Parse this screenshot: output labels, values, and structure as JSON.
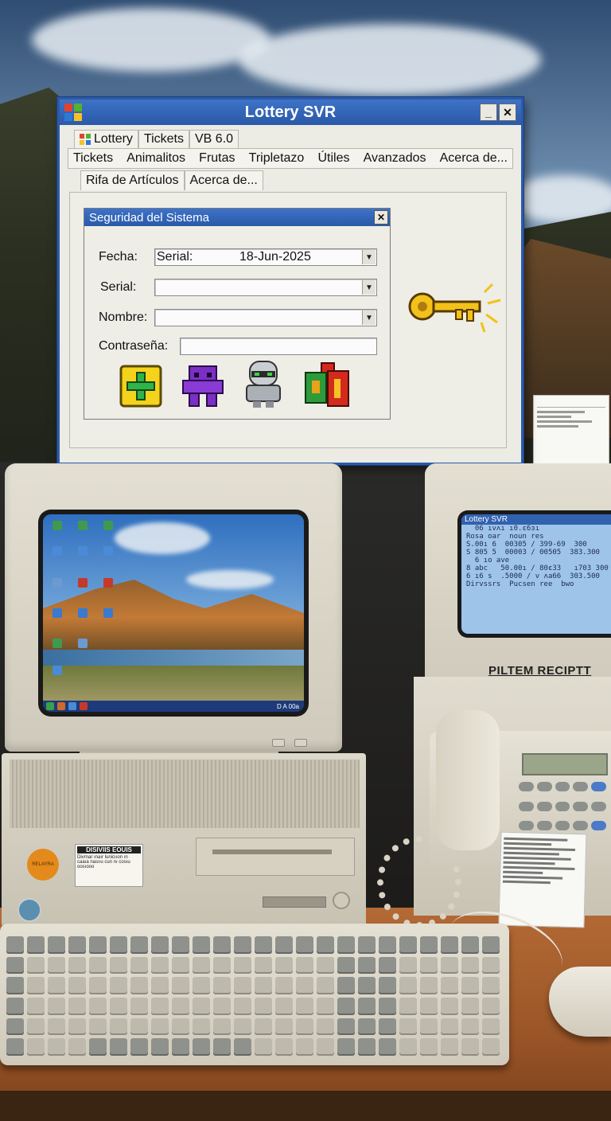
{
  "window": {
    "title": "Lottery SVR",
    "title_buttons": {
      "minimize": "_",
      "close": "✕"
    },
    "top_menu": [
      "Lottery",
      "Tickets",
      "VB 6.0"
    ],
    "menu": [
      "Tickets",
      "Animalitos",
      "Frutas",
      "Tripletazo",
      "Útiles",
      "Avanzados",
      "Acerca de..."
    ],
    "tabs": [
      "Rifa de Artículos",
      "Acerca de..."
    ]
  },
  "dialog": {
    "title": "Seguridad del Sistema",
    "close": "✕",
    "fields": {
      "fecha_label": "Fecha:",
      "fecha_prefix": "Serial:",
      "fecha_value": "18-Jun-2025",
      "serial_label": "Serial:",
      "serial_value": "",
      "nombre_label": "Nombre:",
      "nombre_value": "",
      "password_label": "Contraseña:",
      "password_value": ""
    },
    "icons": [
      "add-icon",
      "purple-creature-icon",
      "robot-icon",
      "red-green-item-icon",
      "golden-key-icon"
    ]
  },
  "scene": {
    "receipt_monitor": {
      "screen_title": "Lottery SVR",
      "rows": [
        "  06 ıvʌı ı0.ɛ6ɜı",
        "Rosa oar  noun res",
        "S.00ı 6  00305 / 399-69  300",
        "S 805 5  00003 / 00505  383.300",
        "  6 ıo ave",
        "8 abc   50.00ı / 80ɛ33   ı703 300",
        "6 ı6 s  .5000 / v ʌa66  303.500",
        "Dirvssrs  Pucsen ree  bwo"
      ],
      "label": "PILTEM RECIPTT"
    },
    "pc_sticker": {
      "heading": "DISIVIIS EOUIS",
      "text": "Divrnar ınaır lunicııon ın caaıa nasııu cun nı cosıu oosıooo"
    },
    "orange_sticker": "RELAYRA",
    "taskbar_clock": "D A 00a"
  },
  "colors": {
    "title_bar": "#2a59a8",
    "window_bg": "#ecebe4",
    "key_gold": "#f2c21a",
    "desk": "#a25a29"
  }
}
